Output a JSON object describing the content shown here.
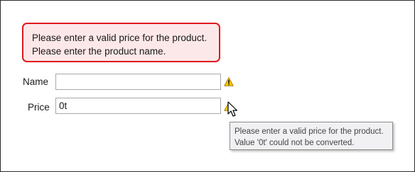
{
  "validation_summary": {
    "errors": [
      "Please enter a valid price for the product.",
      "Please enter the product name."
    ]
  },
  "form": {
    "name": {
      "label": "Name",
      "value": "",
      "has_error": true
    },
    "price": {
      "label": "Price",
      "value": "0t",
      "has_error": true
    }
  },
  "tooltip": {
    "lines": [
      "Please enter a valid price for the product.",
      "Value '0t' could not be converted."
    ]
  },
  "icons": {
    "error_icon": "warning-triangle-icon",
    "pointer": "arrow-cursor-icon"
  },
  "colors": {
    "summary_border": "#e0191f",
    "summary_background": "#fde8e9",
    "warning_yellow": "#f5c400",
    "input_border": "#a9a9a9",
    "tooltip_background": "#f1f1f4"
  }
}
